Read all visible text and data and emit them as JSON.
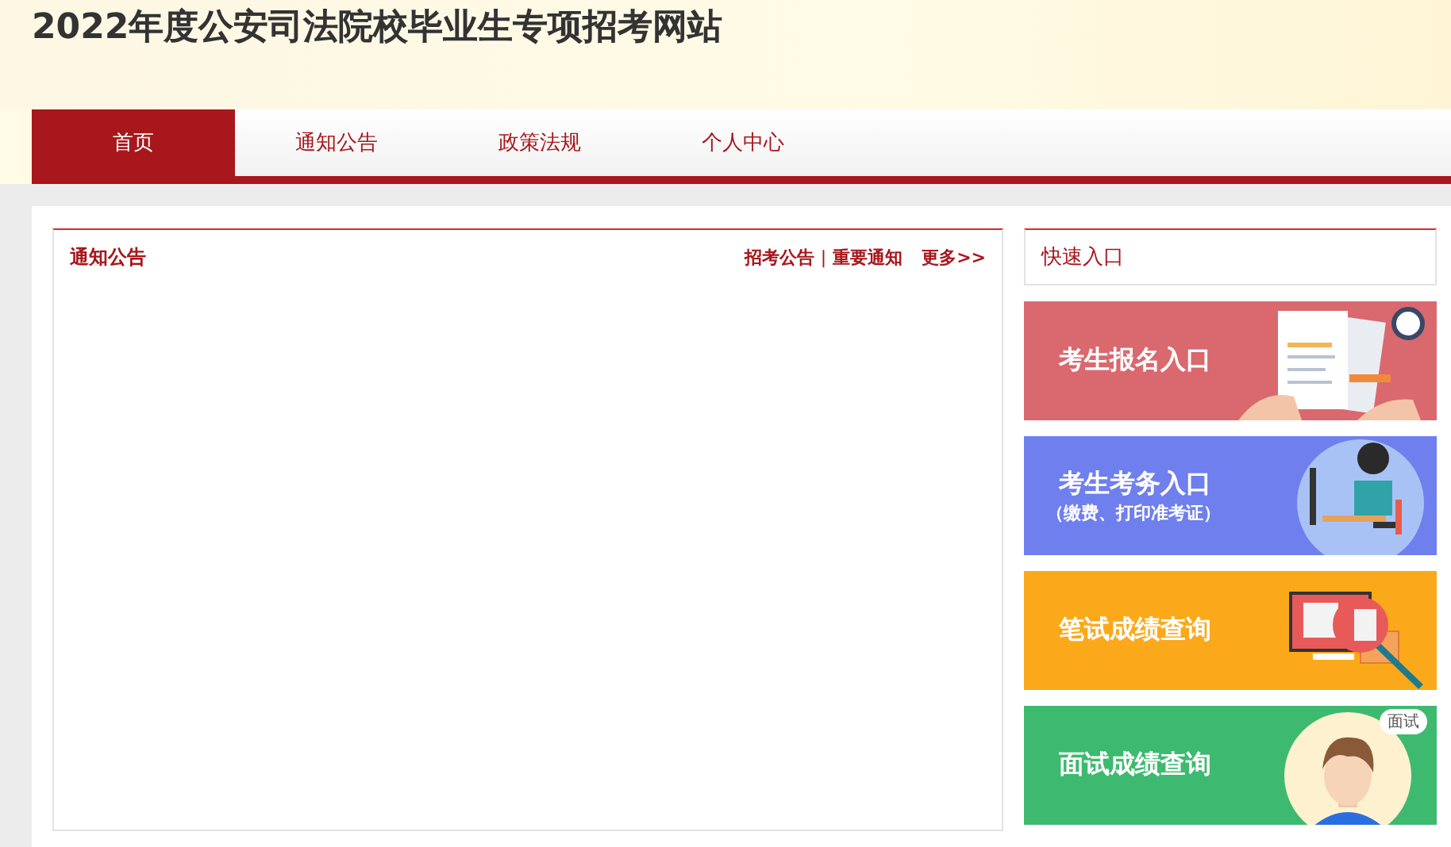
{
  "header": {
    "title": "2022年度公安司法院校毕业生专项招考网站"
  },
  "nav": [
    {
      "label": "首页",
      "selected": true
    },
    {
      "label": "通知公告",
      "selected": false
    },
    {
      "label": "政策法规",
      "selected": false
    },
    {
      "label": "个人中心",
      "selected": false
    }
  ],
  "notices": {
    "title": "通知公告",
    "links": [
      "招考公告",
      "重要通知"
    ],
    "separator": "|",
    "more": "更多>>"
  },
  "quick_entry": {
    "title": "快速入口",
    "banners": [
      {
        "kind": "signup",
        "title": "考生报名入口",
        "color": "#d9696e"
      },
      {
        "kind": "affairs",
        "title": "考生考务入口",
        "subtitle": "（缴费、打印准考证）",
        "color": "#6f7fee"
      },
      {
        "kind": "written",
        "title": "笔试成绩查询",
        "color": "#fba91a"
      },
      {
        "kind": "interview",
        "title": "面试成绩查询",
        "bubble": "面试",
        "color": "#3dba6f"
      }
    ]
  }
}
